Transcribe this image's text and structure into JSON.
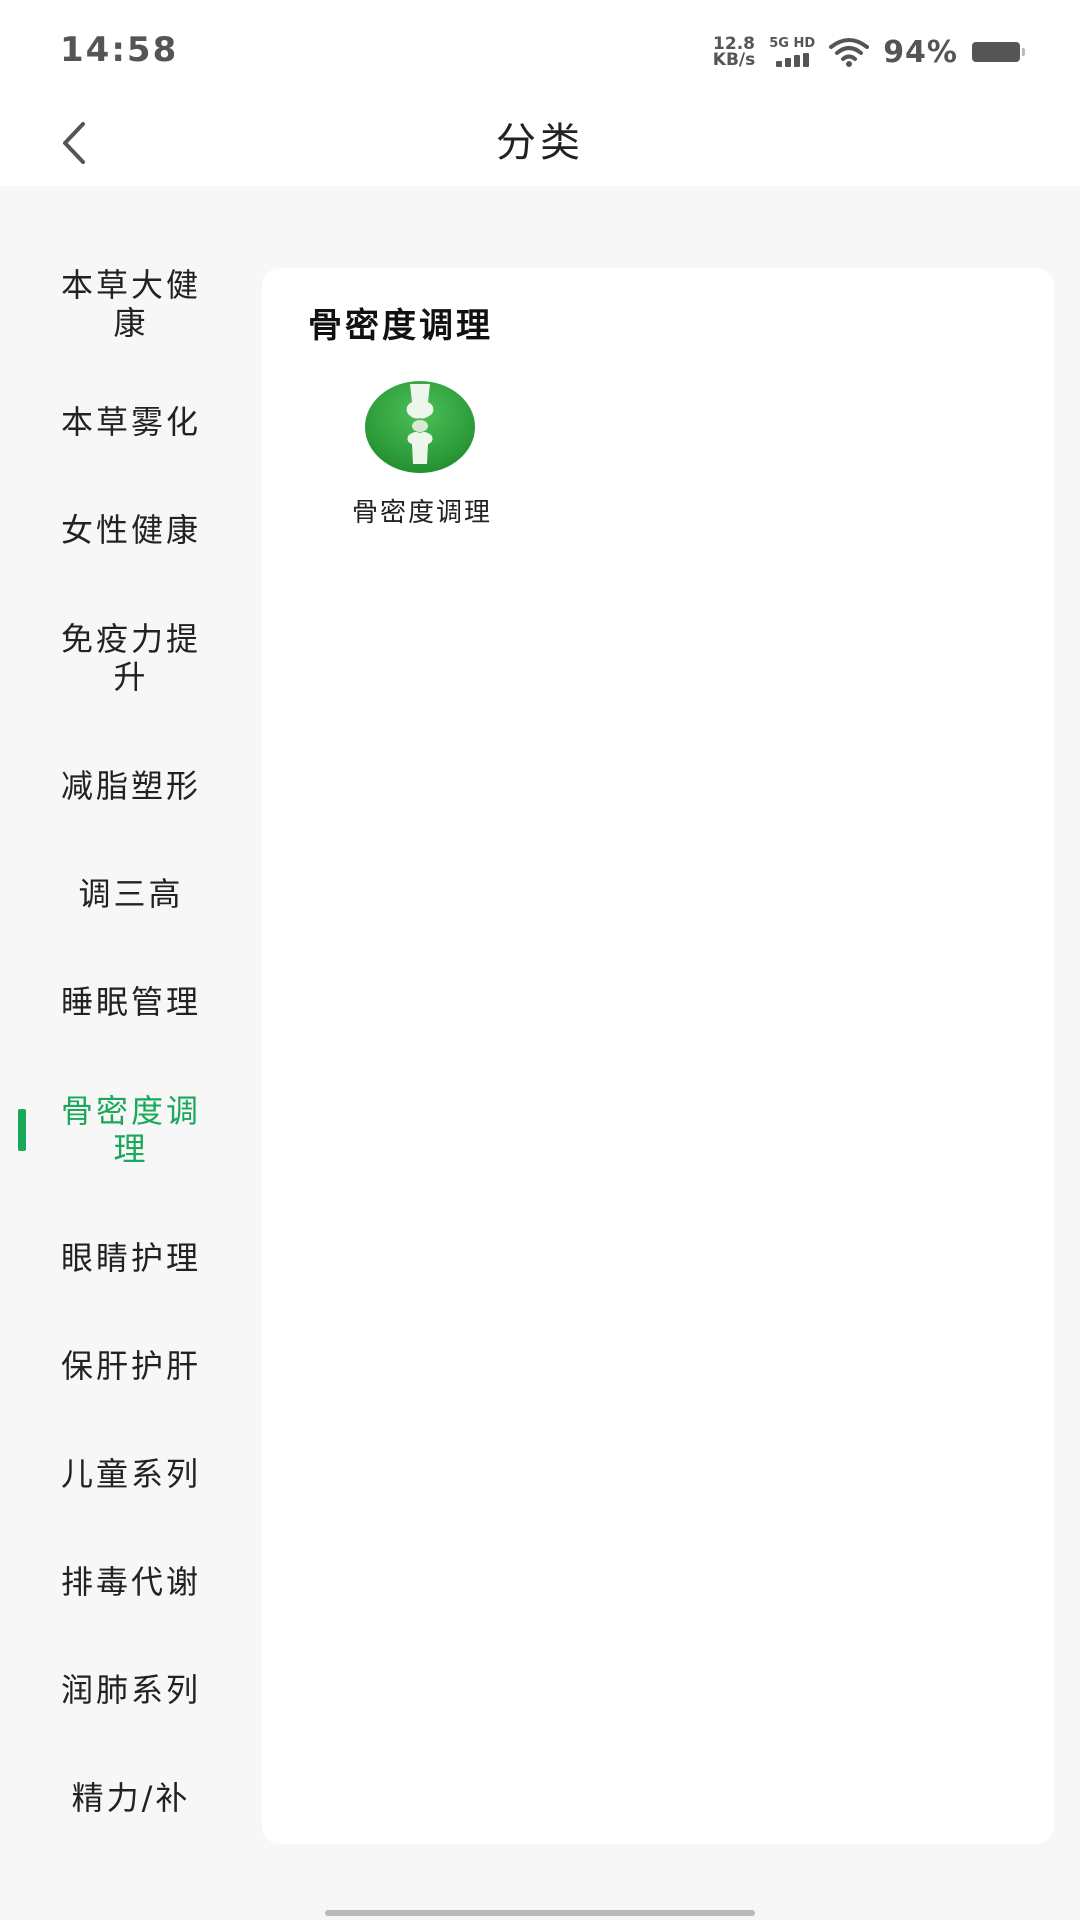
{
  "status_bar": {
    "time": "14:58",
    "net_speed_value": "12.8",
    "net_speed_unit": "KB/s",
    "signal_label": "5G HD",
    "battery_percent": "94%"
  },
  "header": {
    "title": "分类",
    "back_icon": "chevron-left-icon"
  },
  "sidebar": {
    "active_index": 7,
    "accent_color": "#1aa85a",
    "items": [
      {
        "label": "本草大健康"
      },
      {
        "label": "本草雾化"
      },
      {
        "label": "女性健康"
      },
      {
        "label": "免疫力提升"
      },
      {
        "label": "减脂塑形"
      },
      {
        "label": "调三高"
      },
      {
        "label": "睡眠管理"
      },
      {
        "label": "骨密度调理"
      },
      {
        "label": "眼睛护理"
      },
      {
        "label": "保肝护肝"
      },
      {
        "label": "儿童系列"
      },
      {
        "label": "排毒代谢"
      },
      {
        "label": "润肺系列"
      },
      {
        "label": "精力/补"
      }
    ]
  },
  "content": {
    "section_title": "骨密度调理",
    "tiles": [
      {
        "label": "骨密度调理",
        "icon": "bone-joint-icon",
        "icon_color": "#2e9a3c"
      }
    ]
  }
}
